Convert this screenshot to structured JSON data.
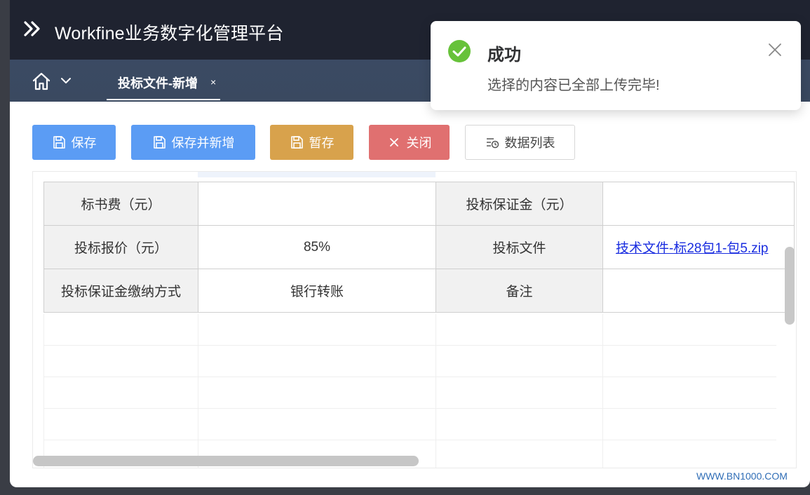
{
  "app": {
    "title": "Workfine业务数字化管理平台"
  },
  "tabs": [
    {
      "label": "投标文件-新增",
      "close": "×"
    }
  ],
  "toolbar": {
    "save": "保存",
    "save_new": "保存并新增",
    "temp_save": "暂存",
    "close": "关闭",
    "data_list": "数据列表"
  },
  "form": {
    "rows": [
      {
        "label1": "标书费（元）",
        "value1": "",
        "label2": "投标保证金（元）",
        "value2": ""
      },
      {
        "label1": "投标报价（元）",
        "value1": "85%",
        "label2": "投标文件",
        "value2": "技术文件-标28包1-包5.zip"
      },
      {
        "label1": "投标保证金缴纳方式",
        "value1": "银行转账",
        "label2": "备注",
        "value2": ""
      }
    ]
  },
  "toast": {
    "title": "成功",
    "message": "选择的内容已全部上传完毕!",
    "status_color": "#67c23a"
  },
  "watermark": "WWW.BN1000.COM"
}
